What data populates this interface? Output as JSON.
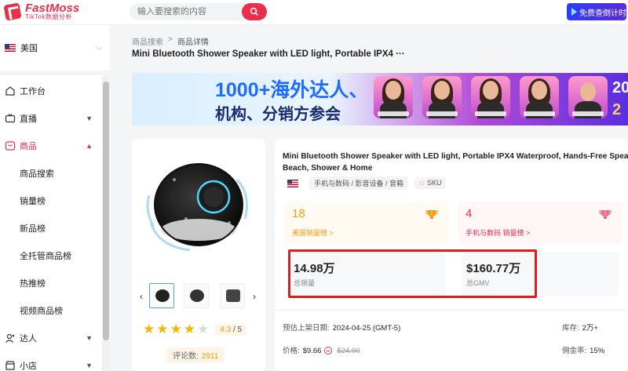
{
  "header": {
    "logo_name": "FastMoss",
    "logo_sub": "TikTok数据分析",
    "search_placeholder": "输入要搜索的内容",
    "trial_label": "免费查倒计时｜天"
  },
  "sidebar": {
    "region": "美国",
    "items": [
      {
        "label": "工作台",
        "icon": "desk-icon"
      },
      {
        "label": "直播",
        "icon": "live-icon"
      },
      {
        "label": "商品",
        "icon": "product-icon"
      },
      {
        "label": "商品搜索"
      },
      {
        "label": "销量榜"
      },
      {
        "label": "新品榜"
      },
      {
        "label": "全托管商品榜"
      },
      {
        "label": "热推榜"
      },
      {
        "label": "视频商品榜"
      },
      {
        "label": "达人",
        "icon": "influencer-icon"
      },
      {
        "label": "小店",
        "icon": "shop-icon"
      }
    ]
  },
  "breadcrumb": {
    "parent": "商品搜索",
    "separator": ">",
    "current": "商品详情"
  },
  "page_title": "Mini Bluetooth Shower Speaker with LED light, Portable IPX4 ···",
  "banner": {
    "line1": "1000+海外达人、",
    "line2": "机构、分销方参会",
    "year_top": "20",
    "year_bottom": "2"
  },
  "product": {
    "title_line1": "Mini Bluetooth Shower Speaker with LED light, Portable IPX4 Waterproof, Hands-Free Speakerph",
    "title_line2": "Beach, Shower & Home",
    "category": "手机与数码 / 影音设备 / 音箱",
    "sku_label": "SKU",
    "rating": "4.3",
    "rating_max": "/ 5",
    "stars": 4,
    "reviews_label": "评论数:",
    "reviews_count": "2911",
    "rank1": {
      "value": "18",
      "label": "美国销量榜 >"
    },
    "rank2": {
      "value": "4",
      "label": "手机与数码 销量榜 >"
    },
    "total_sales": {
      "value": "14.98万",
      "label": "总销量"
    },
    "total_gmv": {
      "value": "$160.77万",
      "label": "总GMV"
    },
    "listing_date_label": "预估上架日期:",
    "listing_date": "2024-04-25 (GMT-5)",
    "stock_label": "库存:",
    "stock": "2万+",
    "price_label": "价格:",
    "price": "$9.66",
    "original_price": "$24.90",
    "commission_label": "佣金率:",
    "commission": "15%"
  },
  "colors": {
    "brand": "#e8304a",
    "rank_orange": "#f39c12",
    "highlight_red": "#e61a1a"
  }
}
